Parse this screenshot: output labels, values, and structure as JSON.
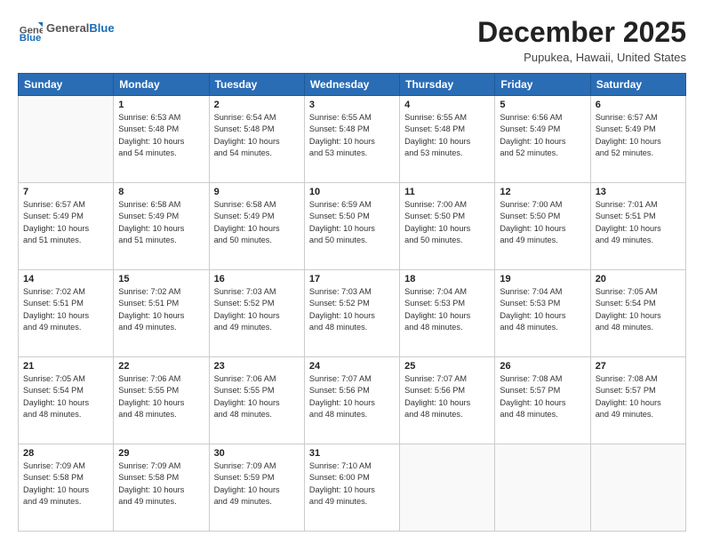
{
  "logo": {
    "general": "General",
    "blue": "Blue"
  },
  "title": "December 2025",
  "location": "Pupukea, Hawaii, United States",
  "days_of_week": [
    "Sunday",
    "Monday",
    "Tuesday",
    "Wednesday",
    "Thursday",
    "Friday",
    "Saturday"
  ],
  "weeks": [
    [
      {
        "day": "",
        "info": ""
      },
      {
        "day": "1",
        "info": "Sunrise: 6:53 AM\nSunset: 5:48 PM\nDaylight: 10 hours\nand 54 minutes."
      },
      {
        "day": "2",
        "info": "Sunrise: 6:54 AM\nSunset: 5:48 PM\nDaylight: 10 hours\nand 54 minutes."
      },
      {
        "day": "3",
        "info": "Sunrise: 6:55 AM\nSunset: 5:48 PM\nDaylight: 10 hours\nand 53 minutes."
      },
      {
        "day": "4",
        "info": "Sunrise: 6:55 AM\nSunset: 5:48 PM\nDaylight: 10 hours\nand 53 minutes."
      },
      {
        "day": "5",
        "info": "Sunrise: 6:56 AM\nSunset: 5:49 PM\nDaylight: 10 hours\nand 52 minutes."
      },
      {
        "day": "6",
        "info": "Sunrise: 6:57 AM\nSunset: 5:49 PM\nDaylight: 10 hours\nand 52 minutes."
      }
    ],
    [
      {
        "day": "7",
        "info": "Sunrise: 6:57 AM\nSunset: 5:49 PM\nDaylight: 10 hours\nand 51 minutes."
      },
      {
        "day": "8",
        "info": "Sunrise: 6:58 AM\nSunset: 5:49 PM\nDaylight: 10 hours\nand 51 minutes."
      },
      {
        "day": "9",
        "info": "Sunrise: 6:58 AM\nSunset: 5:49 PM\nDaylight: 10 hours\nand 50 minutes."
      },
      {
        "day": "10",
        "info": "Sunrise: 6:59 AM\nSunset: 5:50 PM\nDaylight: 10 hours\nand 50 minutes."
      },
      {
        "day": "11",
        "info": "Sunrise: 7:00 AM\nSunset: 5:50 PM\nDaylight: 10 hours\nand 50 minutes."
      },
      {
        "day": "12",
        "info": "Sunrise: 7:00 AM\nSunset: 5:50 PM\nDaylight: 10 hours\nand 49 minutes."
      },
      {
        "day": "13",
        "info": "Sunrise: 7:01 AM\nSunset: 5:51 PM\nDaylight: 10 hours\nand 49 minutes."
      }
    ],
    [
      {
        "day": "14",
        "info": "Sunrise: 7:02 AM\nSunset: 5:51 PM\nDaylight: 10 hours\nand 49 minutes."
      },
      {
        "day": "15",
        "info": "Sunrise: 7:02 AM\nSunset: 5:51 PM\nDaylight: 10 hours\nand 49 minutes."
      },
      {
        "day": "16",
        "info": "Sunrise: 7:03 AM\nSunset: 5:52 PM\nDaylight: 10 hours\nand 49 minutes."
      },
      {
        "day": "17",
        "info": "Sunrise: 7:03 AM\nSunset: 5:52 PM\nDaylight: 10 hours\nand 48 minutes."
      },
      {
        "day": "18",
        "info": "Sunrise: 7:04 AM\nSunset: 5:53 PM\nDaylight: 10 hours\nand 48 minutes."
      },
      {
        "day": "19",
        "info": "Sunrise: 7:04 AM\nSunset: 5:53 PM\nDaylight: 10 hours\nand 48 minutes."
      },
      {
        "day": "20",
        "info": "Sunrise: 7:05 AM\nSunset: 5:54 PM\nDaylight: 10 hours\nand 48 minutes."
      }
    ],
    [
      {
        "day": "21",
        "info": "Sunrise: 7:05 AM\nSunset: 5:54 PM\nDaylight: 10 hours\nand 48 minutes."
      },
      {
        "day": "22",
        "info": "Sunrise: 7:06 AM\nSunset: 5:55 PM\nDaylight: 10 hours\nand 48 minutes."
      },
      {
        "day": "23",
        "info": "Sunrise: 7:06 AM\nSunset: 5:55 PM\nDaylight: 10 hours\nand 48 minutes."
      },
      {
        "day": "24",
        "info": "Sunrise: 7:07 AM\nSunset: 5:56 PM\nDaylight: 10 hours\nand 48 minutes."
      },
      {
        "day": "25",
        "info": "Sunrise: 7:07 AM\nSunset: 5:56 PM\nDaylight: 10 hours\nand 48 minutes."
      },
      {
        "day": "26",
        "info": "Sunrise: 7:08 AM\nSunset: 5:57 PM\nDaylight: 10 hours\nand 48 minutes."
      },
      {
        "day": "27",
        "info": "Sunrise: 7:08 AM\nSunset: 5:57 PM\nDaylight: 10 hours\nand 49 minutes."
      }
    ],
    [
      {
        "day": "28",
        "info": "Sunrise: 7:09 AM\nSunset: 5:58 PM\nDaylight: 10 hours\nand 49 minutes."
      },
      {
        "day": "29",
        "info": "Sunrise: 7:09 AM\nSunset: 5:58 PM\nDaylight: 10 hours\nand 49 minutes."
      },
      {
        "day": "30",
        "info": "Sunrise: 7:09 AM\nSunset: 5:59 PM\nDaylight: 10 hours\nand 49 minutes."
      },
      {
        "day": "31",
        "info": "Sunrise: 7:10 AM\nSunset: 6:00 PM\nDaylight: 10 hours\nand 49 minutes."
      },
      {
        "day": "",
        "info": ""
      },
      {
        "day": "",
        "info": ""
      },
      {
        "day": "",
        "info": ""
      }
    ]
  ]
}
